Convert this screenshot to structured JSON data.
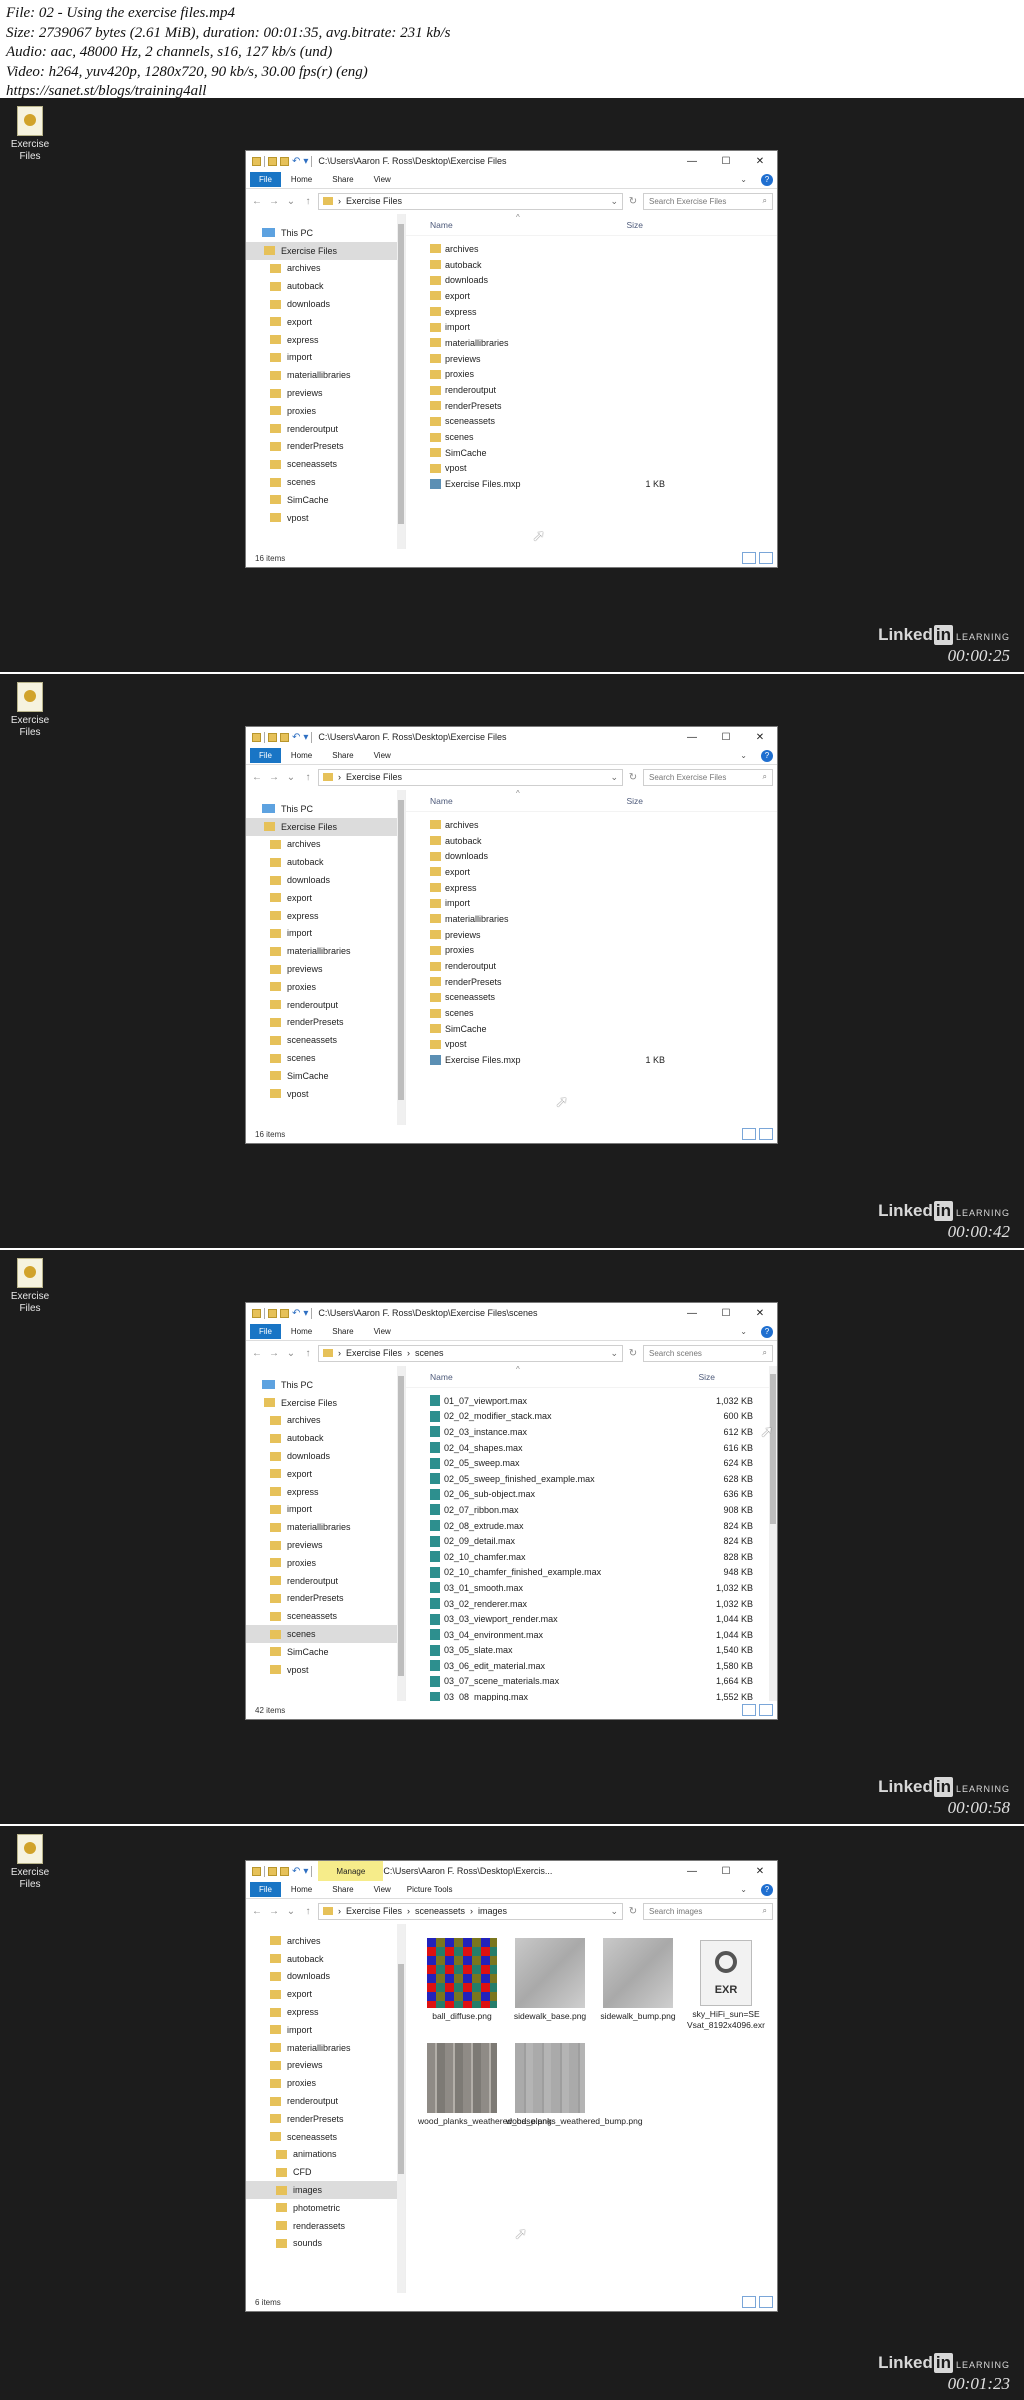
{
  "header_lines": [
    "File: 02 - Using the exercise files.mp4",
    "Size: 2739067 bytes (2.61 MiB), duration: 00:01:35, avg.bitrate: 231 kb/s",
    "Audio: aac, 48000 Hz, 2 channels, s16, 127 kb/s (und)",
    "Video: h264, yuv420p, 1280x720, 90 kb/s, 30.00 fps(r) (eng)",
    " https://sanet.st/blogs/training4all"
  ],
  "desktop_icon_label": "Exercise Files",
  "brand": {
    "linked": "Linked",
    "in": "in",
    "learning": "LEARNING"
  },
  "ribbon": {
    "file": "File",
    "home": "Home",
    "share": "Share",
    "view": "View",
    "picture_tools": "Picture Tools"
  },
  "manage_tab": "Manage",
  "nav_common": {
    "this_pc": "This PC",
    "folders": [
      "archives",
      "autoback",
      "downloads",
      "export",
      "express",
      "import",
      "materiallibraries",
      "previews",
      "proxies",
      "renderoutput",
      "renderPresets",
      "sceneassets",
      "scenes",
      "SimCache",
      "vpost"
    ]
  },
  "frames": [
    {
      "timestamp": "00:00:25",
      "title": "C:\\Users\\Aaron F. Ross\\Desktop\\Exercise Files",
      "crumbs": [
        "Exercise Files"
      ],
      "search": "Search Exercise Files",
      "nav_top": "Exercise Files",
      "col_name": "Name",
      "col_size": "Size",
      "files": [
        {
          "name": "archives"
        },
        {
          "name": "autoback"
        },
        {
          "name": "downloads"
        },
        {
          "name": "export"
        },
        {
          "name": "express"
        },
        {
          "name": "import"
        },
        {
          "name": "materiallibraries"
        },
        {
          "name": "previews"
        },
        {
          "name": "proxies"
        },
        {
          "name": "renderoutput"
        },
        {
          "name": "renderPresets"
        },
        {
          "name": "sceneassets"
        },
        {
          "name": "scenes"
        },
        {
          "name": "SimCache"
        },
        {
          "name": "vpost"
        },
        {
          "name": "Exercise Files.mxp",
          "size": "1 KB"
        }
      ],
      "status": "16 items"
    },
    {
      "timestamp": "00:00:42",
      "title": "C:\\Users\\Aaron F. Ross\\Desktop\\Exercise Files",
      "crumbs": [
        "Exercise Files"
      ],
      "search": "Search Exercise Files",
      "nav_top": "Exercise Files",
      "col_name": "Name",
      "col_size": "Size",
      "files": [
        {
          "name": "archives"
        },
        {
          "name": "autoback"
        },
        {
          "name": "downloads"
        },
        {
          "name": "export"
        },
        {
          "name": "express"
        },
        {
          "name": "import"
        },
        {
          "name": "materiallibraries"
        },
        {
          "name": "previews"
        },
        {
          "name": "proxies"
        },
        {
          "name": "renderoutput"
        },
        {
          "name": "renderPresets"
        },
        {
          "name": "sceneassets"
        },
        {
          "name": "scenes"
        },
        {
          "name": "SimCache"
        },
        {
          "name": "vpost"
        },
        {
          "name": "Exercise Files.mxp",
          "size": "1 KB"
        }
      ],
      "status": "16 items"
    },
    {
      "timestamp": "00:00:58",
      "title": "C:\\Users\\Aaron F. Ross\\Desktop\\Exercise Files\\scenes",
      "crumbs": [
        "Exercise Files",
        "scenes"
      ],
      "search": "Search scenes",
      "nav_top": "Exercise Files",
      "col_name": "Name",
      "col_size": "Size",
      "files": [
        {
          "name": "01_07_viewport.max",
          "size": "1,032 KB"
        },
        {
          "name": "02_02_modifier_stack.max",
          "size": "600 KB"
        },
        {
          "name": "02_03_instance.max",
          "size": "612 KB"
        },
        {
          "name": "02_04_shapes.max",
          "size": "616 KB"
        },
        {
          "name": "02_05_sweep.max",
          "size": "624 KB"
        },
        {
          "name": "02_05_sweep_finished_example.max",
          "size": "628 KB"
        },
        {
          "name": "02_06_sub-object.max",
          "size": "636 KB"
        },
        {
          "name": "02_07_ribbon.max",
          "size": "908 KB"
        },
        {
          "name": "02_08_extrude.max",
          "size": "824 KB"
        },
        {
          "name": "02_09_detail.max",
          "size": "824 KB"
        },
        {
          "name": "02_10_chamfer.max",
          "size": "828 KB"
        },
        {
          "name": "02_10_chamfer_finished_example.max",
          "size": "948 KB"
        },
        {
          "name": "03_01_smooth.max",
          "size": "1,032 KB"
        },
        {
          "name": "03_02_renderer.max",
          "size": "1,032 KB"
        },
        {
          "name": "03_03_viewport_render.max",
          "size": "1,044 KB"
        },
        {
          "name": "03_04_environment.max",
          "size": "1,044 KB"
        },
        {
          "name": "03_05_slate.max",
          "size": "1,540 KB"
        },
        {
          "name": "03_06_edit_material.max",
          "size": "1,580 KB"
        },
        {
          "name": "03_07_scene_materials.max",
          "size": "1,664 KB"
        },
        {
          "name": "03_08_mapping.max",
          "size": "1,552 KB"
        }
      ],
      "status": "42 items"
    },
    {
      "timestamp": "00:01:23",
      "title": "C:\\Users\\Aaron F. Ross\\Desktop\\Exercis...",
      "crumbs": [
        "Exercise Files",
        "sceneassets",
        "images"
      ],
      "search": "Search images",
      "nav_folders": [
        "archives",
        "autoback",
        "downloads",
        "export",
        "express",
        "import",
        "materiallibraries",
        "previews",
        "proxies",
        "renderoutput",
        "renderPresets",
        "sceneassets"
      ],
      "nav_sub": [
        "animations",
        "CFD",
        "images",
        "photometric",
        "renderassets",
        "sounds"
      ],
      "tiles": [
        {
          "name": "ball_diffuse.png",
          "kind": "checker"
        },
        {
          "name": "sidewalk_base.png",
          "kind": "concrete"
        },
        {
          "name": "sidewalk_bump.png",
          "kind": "concrete"
        },
        {
          "name": "sky_HiFi_sun=SE Vsat_8192x4096.exr",
          "kind": "exr",
          "label": "EXR"
        },
        {
          "name": "wood_planks_weathered_base.png",
          "kind": "plank"
        },
        {
          "name": "wood_planks_weathered_bump.png",
          "kind": "bump"
        }
      ],
      "status": "6 items"
    }
  ]
}
